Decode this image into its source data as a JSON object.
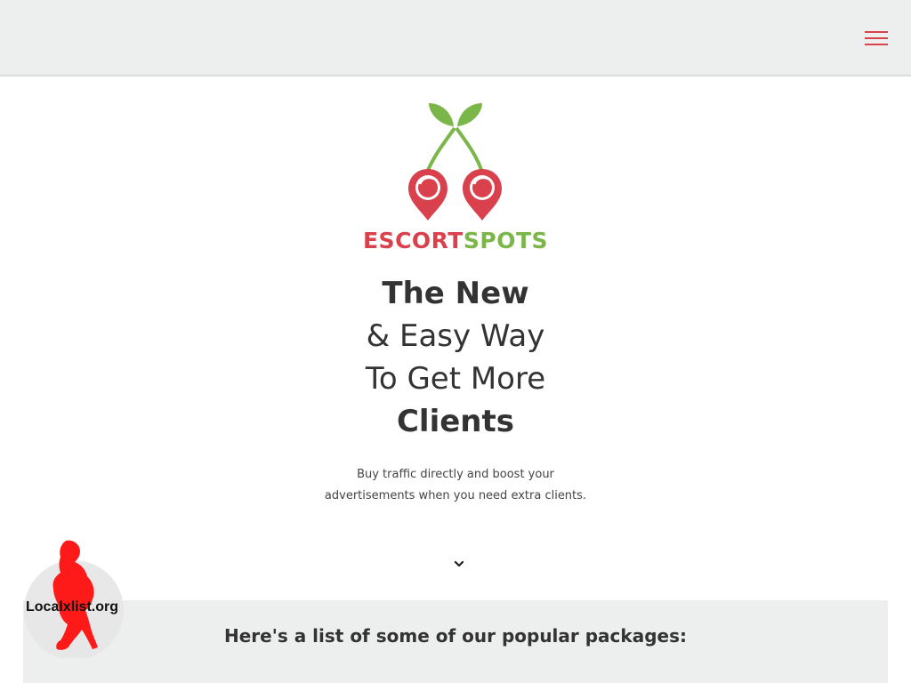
{
  "header": {
    "menu_icon": "hamburger-menu-icon",
    "accent": "#d9414d"
  },
  "logo": {
    "icon": "cherries-location-pin-icon",
    "brand_part1": "ESCORT",
    "brand_part2": "SPOTS",
    "red": "#d9414d",
    "green": "#7ab648"
  },
  "hero": {
    "line1": "The New",
    "line2": "& Easy Way",
    "line3": "To Get More",
    "line4": "Clients",
    "subtitle_line1": "Buy traffic directly and boost your",
    "subtitle_line2": "advertisements when you need extra clients.",
    "scroll_icon": "chevron-down-icon"
  },
  "packages": {
    "title": "Here's a list of some of our popular packages:"
  },
  "watermark": {
    "text": "Localxlist.org",
    "icon": "silhouette-watermark-icon"
  }
}
